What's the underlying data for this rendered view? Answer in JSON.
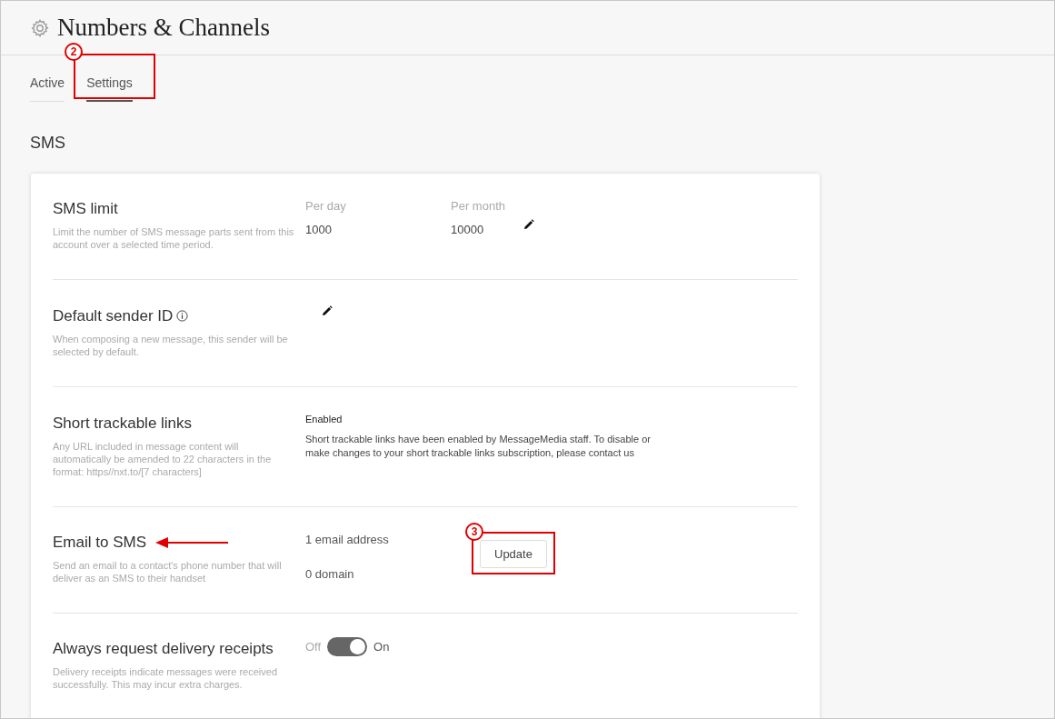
{
  "page": {
    "title": "Numbers & Channels"
  },
  "tabs": [
    {
      "label": "Active",
      "selected": false
    },
    {
      "label": "Settings",
      "selected": true,
      "callout": "2"
    }
  ],
  "section_title": "SMS",
  "settings": [
    {
      "kind": "limit",
      "title": "SMS limit",
      "description": "Limit the number of SMS message parts sent from this account over a selected time period.",
      "fields": [
        {
          "label": "Per day",
          "value": "1000"
        },
        {
          "label": "Per month",
          "value": "10000"
        }
      ]
    },
    {
      "kind": "sender",
      "title": "Default sender ID",
      "description": "When composing a new message, this sender will be selected by default."
    },
    {
      "kind": "info",
      "title": "Short trackable links",
      "description": "Any URL included in message content will automatically be amended to 22 characters in the format: https//nxt.to/[7 characters]",
      "status": "Enabled",
      "message": "Short trackable links have been enabled by MessageMedia staff. To disable or make changes to your short trackable links subscription, please contact us"
    },
    {
      "kind": "email",
      "title": "Email to SMS",
      "description": "Send an email to a contact's phone number that will deliver as an SMS to their handset",
      "lines": [
        "1 email address",
        "0 domain"
      ],
      "button": {
        "label": "Update",
        "callout": "3"
      },
      "arrow": true
    },
    {
      "kind": "toggle",
      "title": "Always request delivery receipts",
      "description": "Delivery receipts indicate messages were received successfully. This may incur extra charges.",
      "off_label": "Off",
      "on_label": "On",
      "on": true
    }
  ]
}
